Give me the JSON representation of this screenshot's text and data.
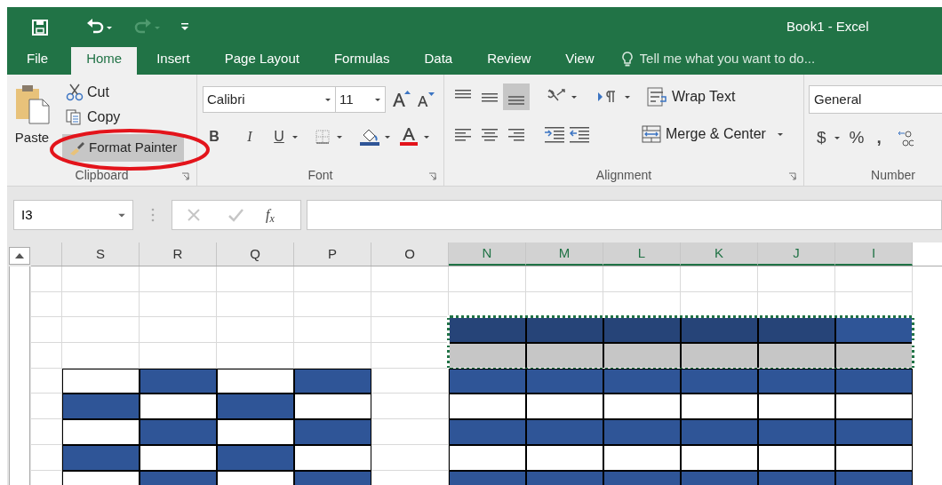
{
  "window": {
    "title": "Book1 - Excel"
  },
  "quick_access": [
    {
      "kind": "save",
      "disabled": false
    },
    {
      "kind": "undo",
      "disabled": false
    },
    {
      "kind": "redo",
      "disabled": true
    },
    {
      "kind": "customize",
      "disabled": false
    }
  ],
  "tabs": [
    {
      "label": "File",
      "selected": false
    },
    {
      "label": "Home",
      "selected": true
    },
    {
      "label": "Insert",
      "selected": false
    },
    {
      "label": "Page Layout",
      "selected": false
    },
    {
      "label": "Formulas",
      "selected": false
    },
    {
      "label": "Data",
      "selected": false
    },
    {
      "label": "Review",
      "selected": false
    },
    {
      "label": "View",
      "selected": false
    }
  ],
  "tell_me": {
    "placeholder": "Tell me what you want to do..."
  },
  "ribbon": {
    "clipboard": {
      "label": "Clipboard",
      "paste": "Paste",
      "cut": "Cut",
      "copy": "Copy",
      "format_painter": {
        "label": "Format Painter",
        "on": true
      }
    },
    "font": {
      "label": "Font",
      "font_name": "Calibri",
      "font_size": "11",
      "bold": "B",
      "italic": "I",
      "underline": "U"
    },
    "alignment": {
      "label": "Alignment",
      "wrap_text": "Wrap Text",
      "merge_center": "Merge & Center",
      "bottom_align_on": true
    },
    "number": {
      "label": "Number",
      "format": "General",
      "currency": "$",
      "percent": "%",
      "comma": ","
    }
  },
  "formula_bar": {
    "name_box": "I3",
    "function_label": "f$_{x}$"
  },
  "sheet": {
    "columns": [
      {
        "selected": false
      },
      {
        "label": "S",
        "selected": false
      },
      {
        "label": "R",
        "selected": false
      },
      {
        "label": "Q",
        "selected": false
      },
      {
        "label": "P",
        "selected": false
      },
      {
        "label": "O",
        "selected": false
      },
      {
        "label": "N",
        "selected": true
      },
      {
        "label": "M",
        "selected": true
      },
      {
        "label": "L",
        "selected": true
      },
      {
        "label": "K",
        "selected": true
      },
      {
        "label": "J",
        "selected": true
      },
      {
        "label": "I",
        "selected": true
      }
    ],
    "rows": [
      {
        "in_copy_range": false,
        "cells": [
          null,
          null,
          null,
          null,
          null,
          null,
          null,
          null,
          null,
          null,
          null,
          null
        ]
      },
      {
        "in_copy_range": false,
        "cells": [
          null,
          null,
          null,
          null,
          null,
          null,
          null,
          null,
          null,
          null,
          null,
          null
        ]
      },
      {
        "in_copy_range": true,
        "cells": [
          null,
          null,
          null,
          null,
          null,
          null,
          {
            "color": "#264478"
          },
          {
            "color": "#264478"
          },
          {
            "color": "#264478"
          },
          {
            "color": "#264478"
          },
          {
            "color": "#264478"
          },
          {
            "color": "#2f5597"
          }
        ]
      },
      {
        "in_copy_range": true,
        "cells": [
          null,
          null,
          null,
          null,
          null,
          null,
          {
            "color": "#c6c6c6"
          },
          {
            "color": "#c6c6c6"
          },
          {
            "color": "#c6c6c6"
          },
          {
            "color": "#c6c6c6"
          },
          {
            "color": "#c6c6c6"
          },
          {
            "color": "#c6c6c6"
          }
        ]
      },
      {
        "in_copy_range": false,
        "cells": [
          null,
          {
            "color": "#ffffff"
          },
          {
            "color": "#2f5597"
          },
          {
            "color": "#ffffff"
          },
          {
            "color": "#2f5597"
          },
          null,
          {
            "color": "#2f5597"
          },
          {
            "color": "#2f5597"
          },
          {
            "color": "#2f5597"
          },
          {
            "color": "#2f5597"
          },
          {
            "color": "#2f5597"
          },
          {
            "color": "#2f5597"
          }
        ]
      },
      {
        "in_copy_range": false,
        "cells": [
          null,
          {
            "color": "#2f5597"
          },
          {
            "color": "#ffffff"
          },
          {
            "color": "#2f5597"
          },
          {
            "color": "#ffffff"
          },
          null,
          {
            "color": "#ffffff"
          },
          {
            "color": "#ffffff"
          },
          {
            "color": "#ffffff"
          },
          {
            "color": "#ffffff"
          },
          {
            "color": "#ffffff"
          },
          {
            "color": "#ffffff"
          }
        ]
      },
      {
        "in_copy_range": false,
        "cells": [
          null,
          {
            "color": "#ffffff"
          },
          {
            "color": "#2f5597"
          },
          {
            "color": "#ffffff"
          },
          {
            "color": "#2f5597"
          },
          null,
          {
            "color": "#2f5597"
          },
          {
            "color": "#2f5597"
          },
          {
            "color": "#2f5597"
          },
          {
            "color": "#2f5597"
          },
          {
            "color": "#2f5597"
          },
          {
            "color": "#2f5597"
          }
        ]
      },
      {
        "in_copy_range": false,
        "cells": [
          null,
          {
            "color": "#2f5597"
          },
          {
            "color": "#ffffff"
          },
          {
            "color": "#2f5597"
          },
          {
            "color": "#ffffff"
          },
          null,
          {
            "color": "#ffffff"
          },
          {
            "color": "#ffffff"
          },
          {
            "color": "#ffffff"
          },
          {
            "color": "#ffffff"
          },
          {
            "color": "#ffffff"
          },
          {
            "color": "#ffffff"
          }
        ]
      },
      {
        "in_copy_range": false,
        "cells": [
          null,
          {
            "color": "#ffffff"
          },
          {
            "color": "#2f5597"
          },
          {
            "color": "#ffffff"
          },
          {
            "color": "#2f5597"
          },
          null,
          {
            "color": "#2f5597"
          },
          {
            "color": "#2f5597"
          },
          {
            "color": "#2f5597"
          },
          {
            "color": "#2f5597"
          },
          {
            "color": "#2f5597"
          },
          {
            "color": "#2f5597"
          }
        ]
      }
    ]
  }
}
